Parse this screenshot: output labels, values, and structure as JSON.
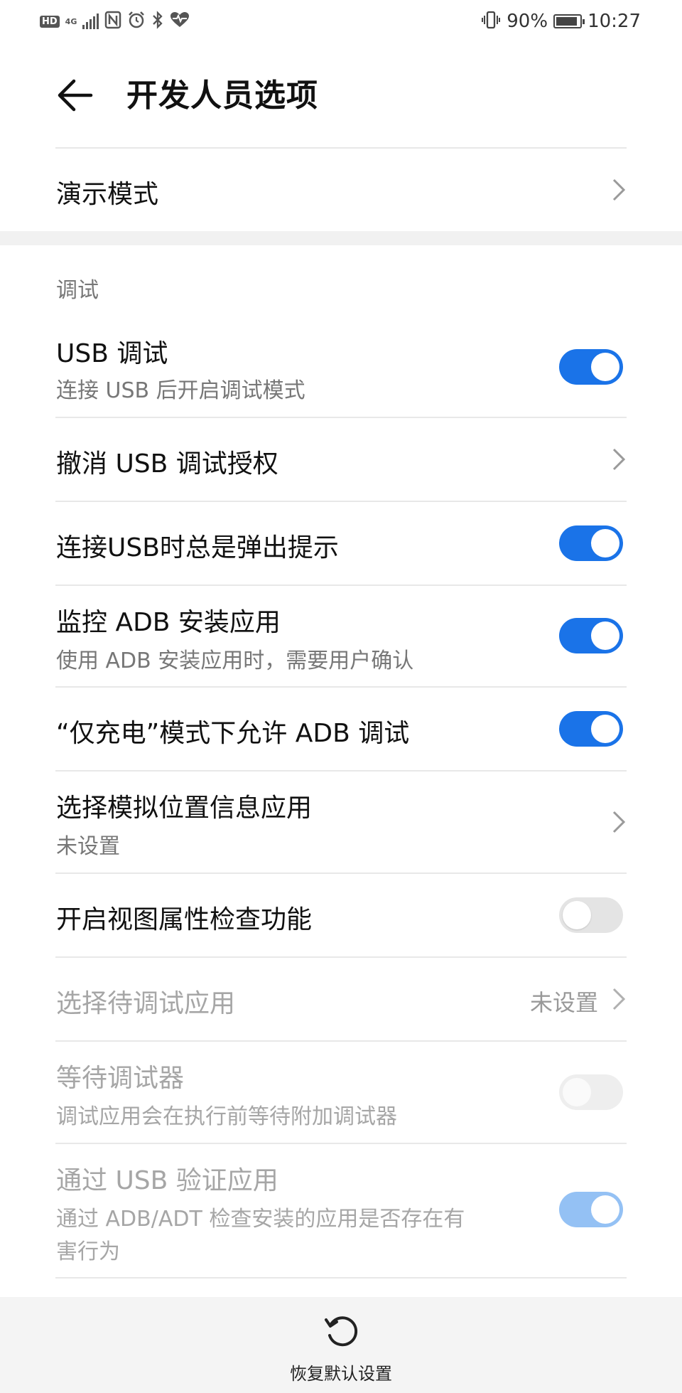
{
  "status_bar": {
    "hd": "HD",
    "network": "4G",
    "battery_percent": "90%",
    "time": "10:27",
    "battery_level": 0.9
  },
  "header": {
    "title": "开发人员选项"
  },
  "demo_mode": {
    "label": "演示模式"
  },
  "debug_section": {
    "title": "调试",
    "items": [
      {
        "label": "USB 调试",
        "sub": "连接 USB 后开启调试模式",
        "control": "toggle",
        "checked": true
      },
      {
        "label": "撤消 USB 调试授权",
        "control": "chevron"
      },
      {
        "label": "连接USB时总是弹出提示",
        "control": "toggle",
        "checked": true
      },
      {
        "label": "监控 ADB 安装应用",
        "sub": "使用 ADB 安装应用时，需要用户确认",
        "control": "toggle",
        "checked": true
      },
      {
        "label": "“仅充电”模式下允许 ADB 调试",
        "control": "toggle",
        "checked": true
      },
      {
        "label": "选择模拟位置信息应用",
        "sub": "未设置",
        "control": "chevron"
      },
      {
        "label": "开启视图属性检查功能",
        "control": "toggle",
        "checked": false
      },
      {
        "label": "选择待调试应用",
        "value": "未设置",
        "control": "chevron",
        "disabled": true
      },
      {
        "label": "等待调试器",
        "sub": "调试应用会在执行前等待附加调试器",
        "control": "toggle",
        "checked": false,
        "disabled": true
      },
      {
        "label": "通过 USB 验证应用",
        "sub_line1": "通过 ADB/ADT 检查安装的应用是否存在有",
        "sub_line2": "害行为",
        "control": "toggle",
        "checked": true,
        "disabled": true
      }
    ]
  },
  "bottom_bar": {
    "reset_label": "恢复默认设置"
  },
  "colors": {
    "accent": "#1a73e8",
    "accent_disabled": "#94c1f4",
    "divider": "#e8e8e8",
    "band": "#f1f1f1"
  }
}
